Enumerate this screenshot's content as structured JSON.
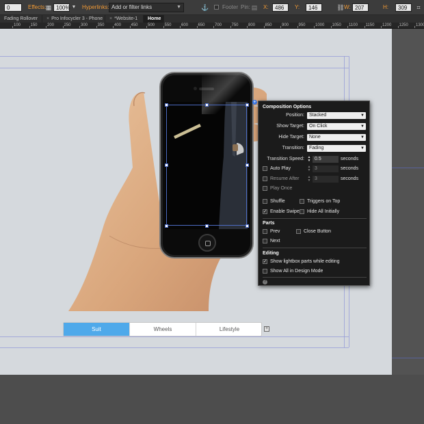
{
  "control_bar": {
    "rotation_value": "0",
    "effects_label": "Effects:",
    "opacity_value": "100%",
    "hyperlinks_label": "Hyperlinks:",
    "hyperlinks_placeholder": "Add or filter links",
    "footer_label": "Footer",
    "pin_label": "Pin:",
    "x_label": "X:",
    "x_value": "486",
    "y_label": "Y:",
    "y_value": "146",
    "w_label": "W:",
    "w_value": "207",
    "h_label": "H:",
    "h_value": "309"
  },
  "tabs": [
    {
      "label": "Fading Rollover",
      "active": false
    },
    {
      "label": "Pro Infocycler 3 - Phone",
      "active": false
    },
    {
      "label": "*Website-1",
      "active": false
    },
    {
      "label": "Home",
      "active": true
    }
  ],
  "ruler": {
    "ticks": [
      "100",
      "150",
      "200",
      "250",
      "300",
      "350",
      "400",
      "450",
      "500",
      "550",
      "600",
      "650",
      "700",
      "750",
      "800",
      "850",
      "900",
      "950",
      "1000",
      "1050",
      "1100",
      "1150",
      "1200",
      "1250",
      "1300"
    ]
  },
  "panel": {
    "title": "Composition Options",
    "position_label": "Position:",
    "position_value": "Stacked",
    "show_target_label": "Show Target:",
    "show_target_value": "On Click",
    "hide_target_label": "Hide Target:",
    "hide_target_value": "None",
    "transition_label": "Transition:",
    "transition_value": "Fading",
    "transition_speed_label": "Transition Speed:",
    "transition_speed_value": "0.5",
    "seconds_unit": "seconds",
    "auto_play_label": "Auto Play",
    "auto_play_value": "3",
    "resume_after_label": "Resume After",
    "resume_after_value": "3",
    "play_once_label": "Play Once",
    "shuffle_label": "Shuffle",
    "triggers_on_top_label": "Triggers on Top",
    "enable_swipe_label": "Enable Swipe",
    "hide_all_initially_label": "Hide All Initially",
    "parts_label": "Parts",
    "prev_label": "Prev",
    "close_button_label": "Close Button",
    "next_label": "Next",
    "editing_label": "Editing",
    "show_lightbox_label": "Show lightbox parts while editing",
    "show_all_design_label": "Show All in Design Mode",
    "help_glyph": "?",
    "anchor_glyph": "+"
  },
  "widget_tabs": [
    {
      "label": "Suit",
      "active": true
    },
    {
      "label": "Wheels",
      "active": false
    },
    {
      "label": "Lifestyle",
      "active": false
    }
  ],
  "widget_add_glyph": "+",
  "colors": {
    "accent_blue": "#4fa9ea",
    "label_orange": "#f29a35",
    "selection_blue": "#4d6cc4"
  }
}
